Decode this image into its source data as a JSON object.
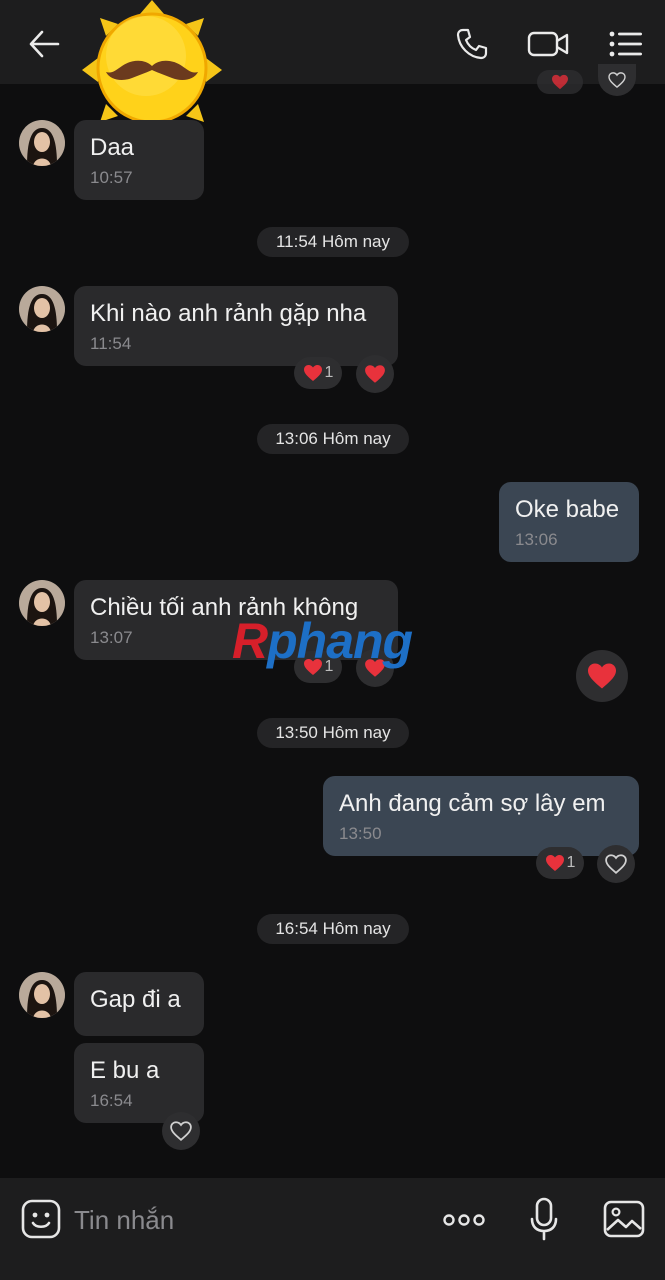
{
  "header": {
    "contact_name": "",
    "icons": [
      "back-arrow-icon",
      "phone-icon",
      "video-call-icon",
      "list-menu-icon"
    ]
  },
  "sticker": {
    "name": "sun-mustache-sticker"
  },
  "messages": {
    "m1": {
      "text": "Daa",
      "time": "10:57"
    },
    "d1": "11:54 Hôm nay",
    "m2": {
      "text": "Khi nào anh rảnh gặp nha",
      "time": "11:54",
      "reaction_count": "1"
    },
    "d2": "13:06 Hôm nay",
    "m3": {
      "text": "Oke babe",
      "time": "13:06"
    },
    "m4": {
      "text": "Chiều tối anh rảnh không",
      "time": "13:07",
      "reaction_count": "1"
    },
    "d3": "13:50 Hôm nay",
    "m5": {
      "text": "Anh đang cảm sợ lây em",
      "time": "13:50",
      "reaction_count": "1"
    },
    "d4": "16:54 Hôm nay",
    "m6": {
      "text": "Gap đi a"
    },
    "m7": {
      "text": "E bu a",
      "time": "16:54"
    }
  },
  "watermark": {
    "part1": "R",
    "part2": "phang"
  },
  "composer": {
    "placeholder": "Tin nhắn"
  },
  "colors": {
    "background": "#0e0e0f",
    "incoming_bubble": "#2a2a2c",
    "outgoing_bubble": "#3b4653",
    "heart": "#e8323c"
  }
}
